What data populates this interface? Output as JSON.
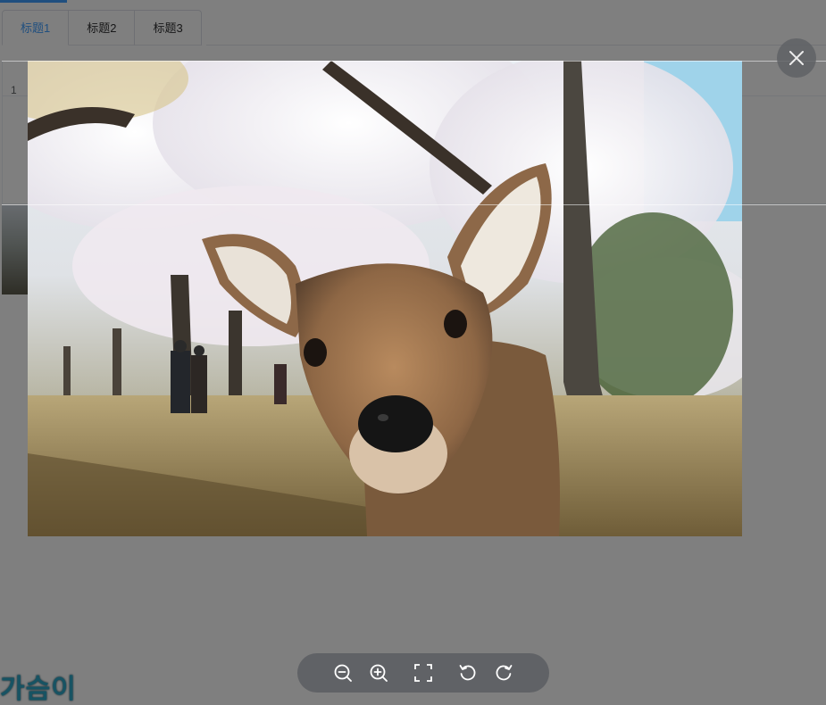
{
  "tabs": [
    {
      "label": "标题1",
      "active": true
    },
    {
      "label": "标题2",
      "active": false
    },
    {
      "label": "标题3",
      "active": false
    }
  ],
  "table": {
    "row_index": "1"
  },
  "footer": {
    "text": "가슴이"
  },
  "image_viewer": {
    "image_description_icon": "photo-deer-cherry-blossoms",
    "close_icon": "close-icon",
    "toolbar": [
      {
        "name": "zoom-out-icon"
      },
      {
        "name": "zoom-in-icon"
      },
      {
        "name": "fullscreen-icon"
      },
      {
        "name": "rotate-left-icon"
      },
      {
        "name": "rotate-right-icon"
      }
    ]
  },
  "colors": {
    "accent": "#409eff",
    "toolbar_bg": "#606266",
    "mask": "rgba(0,0,0,0.5)"
  }
}
